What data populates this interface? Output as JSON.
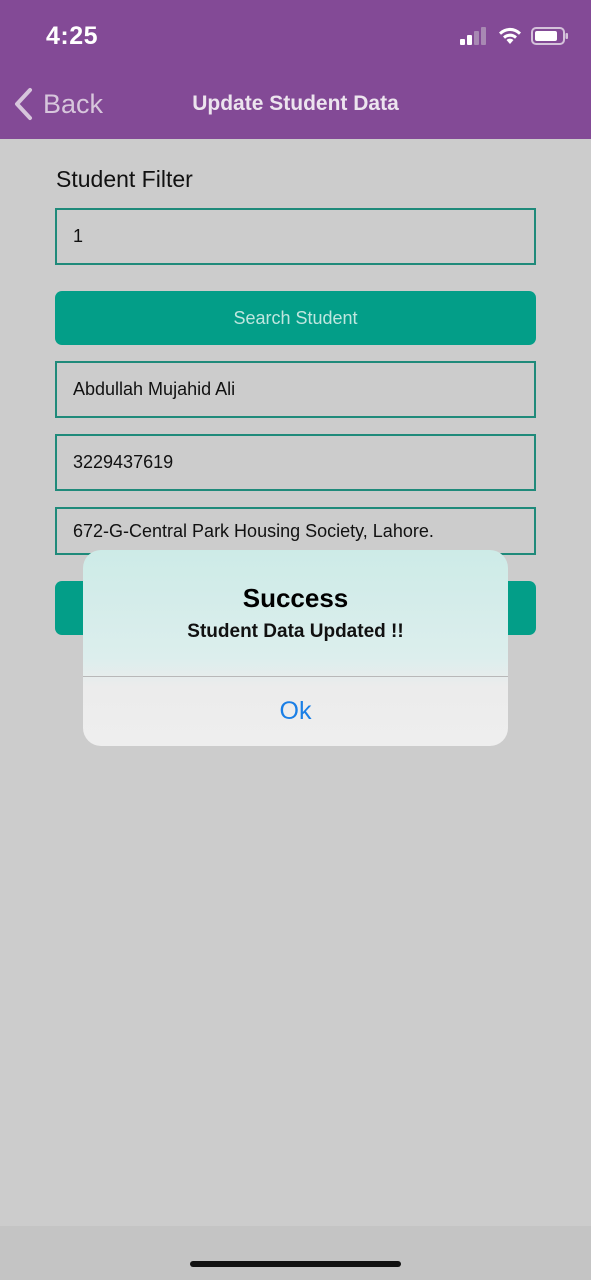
{
  "status_bar": {
    "time": "4:25"
  },
  "nav": {
    "back_label": "Back",
    "title": "Update Student Data"
  },
  "form": {
    "filter_label": "Student Filter",
    "filter_value": "1",
    "search_button": "Search Student",
    "name_value": "Abdullah Mujahid Ali",
    "phone_value": "3229437619",
    "address_value": "672-G-Central Park Housing Society, Lahore."
  },
  "alert": {
    "title": "Success",
    "message": "Student Data Updated !!",
    "ok_label": "Ok"
  },
  "colors": {
    "header": "#834a96",
    "accent": "#039e88",
    "field_border": "#1f8a7a",
    "link_blue": "#1a7fe6",
    "background": "#cccccc"
  },
  "icons": [
    "signal-icon",
    "wifi-icon",
    "battery-icon",
    "chevron-left-icon"
  ]
}
